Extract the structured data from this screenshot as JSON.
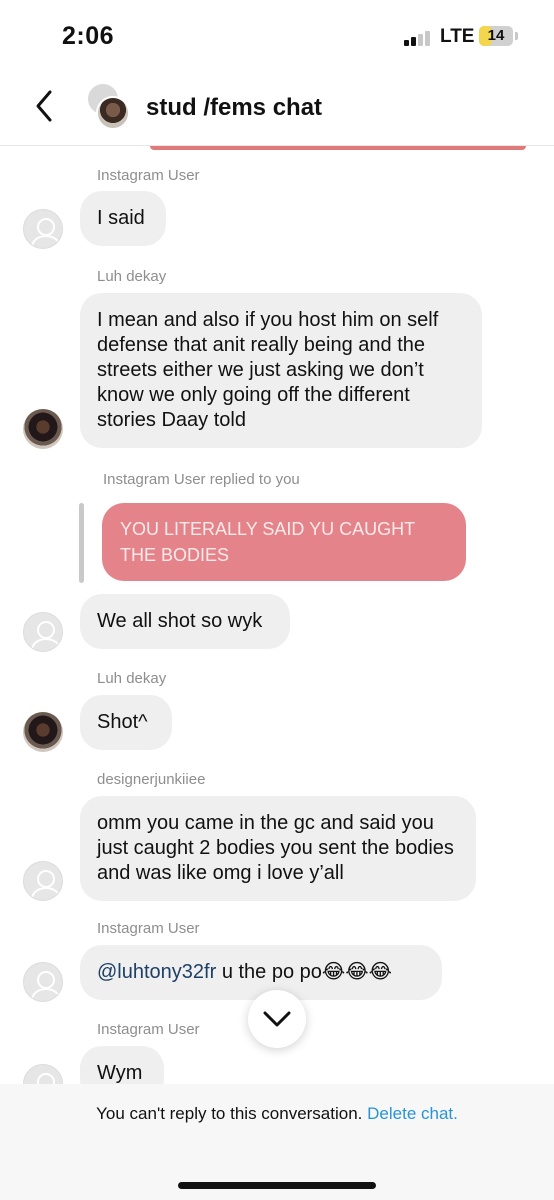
{
  "status_bar": {
    "time": "2:06",
    "network": "LTE",
    "battery": "14",
    "battery_level": 0.14,
    "signal_bars": 2
  },
  "header": {
    "title": "stud /fems chat",
    "back_icon": "chevron-left-icon"
  },
  "messages": [
    {
      "sender": "Instagram User",
      "text": "I said"
    },
    {
      "sender": "Luh dekay",
      "text": "I mean and also if you host him on self defense that anit really being and the streets either we just asking we don’t know we only going off the different stories Daay told"
    },
    {
      "reply_label": "Instagram User replied to you",
      "quoted_text": "YOU LITERALLY SAID YU CAUGHT THE BODIES",
      "text": "We all shot so wyk"
    },
    {
      "sender": "Luh dekay",
      "text": "Shot^"
    },
    {
      "sender": "designerjunkiiee",
      "text": "omm you came in the gc and said you just caught 2 bodies you sent the bodies and was like omg i love y’all"
    },
    {
      "sender": "Instagram User",
      "mention": "@luhtony32fr",
      "text": " u the po po😂😂😂"
    },
    {
      "sender": "Instagram User",
      "text": "Wym"
    }
  ],
  "footer": {
    "notice": "You can't reply to this conversation.",
    "delete_link": "Delete chat."
  },
  "colors": {
    "reply_bubble": "#e5838a",
    "link": "#2a93d5",
    "bubble_gray": "#efefef"
  },
  "icons": [
    "chevron-left-icon",
    "chevron-down-icon",
    "default-avatar-icon"
  ]
}
